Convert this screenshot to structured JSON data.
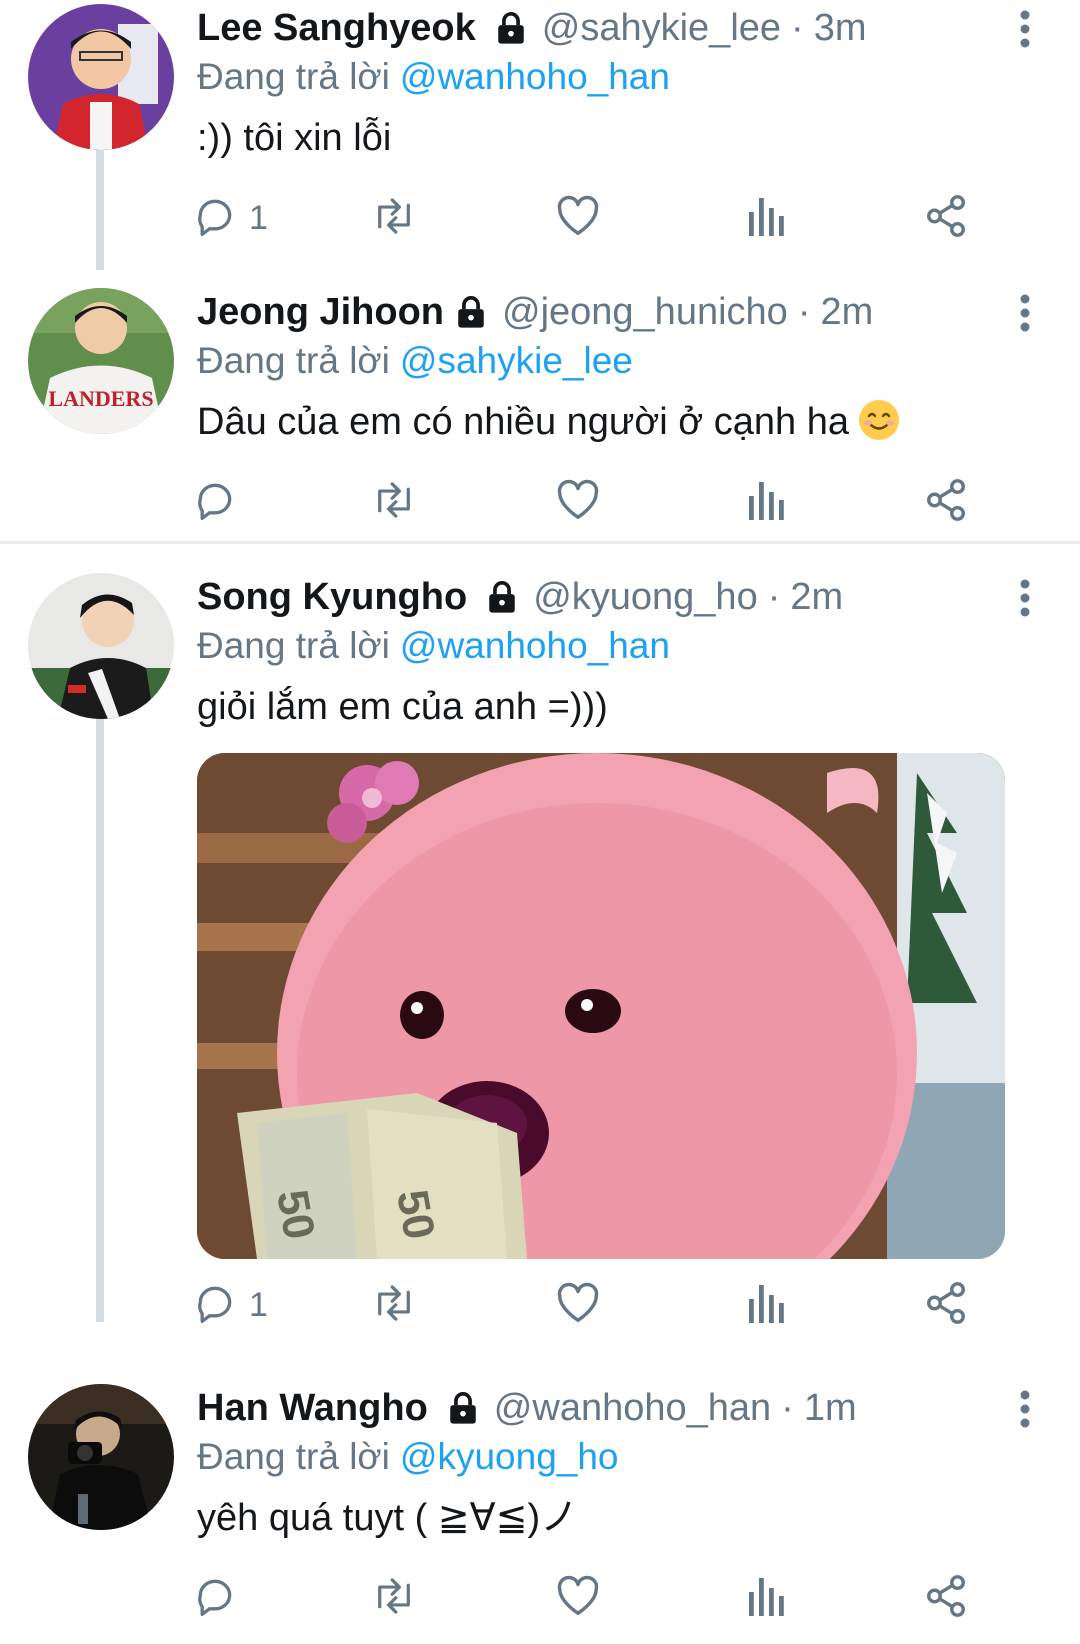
{
  "tweets": [
    {
      "name": "Lee Sanghyeok",
      "handle": "@sahykie_lee",
      "time": "3m",
      "replying_label": "Đang trả lời",
      "replying_to": "@wanhoho_han",
      "text": ":)) tôi xin lỗi",
      "reply_count": "1"
    },
    {
      "name": "Jeong Jihoon",
      "handle": "@jeong_hunicho",
      "time": "2m",
      "replying_label": "Đang trả lời",
      "replying_to": "@sahykie_lee",
      "text": "Dâu của em có nhiều người ở cạnh ha",
      "reply_count": ""
    },
    {
      "name": "Song Kyungho",
      "handle": "@kyuong_ho",
      "time": "2m",
      "replying_label": "Đang trả lời",
      "replying_to": "@wanhoho_han",
      "text": "giỏi lắm em của anh =)))",
      "reply_count": "1",
      "media_caption": "50"
    },
    {
      "name": "Han Wangho",
      "handle": "@wanhoho_han",
      "time": "1m",
      "replying_label": "Đang trả lời",
      "replying_to": "@kyuong_ho",
      "text": "yêh quá tuyt ( ≧∀≦)ノ",
      "reply_count": ""
    }
  ],
  "separator": "·",
  "icons": {
    "lock": "lock-icon",
    "more": "more-vertical-icon",
    "reply": "reply-icon",
    "retweet": "retweet-icon",
    "like": "heart-icon",
    "analytics": "analytics-icon",
    "share": "share-icon",
    "emoji": "smiling-face-emoji"
  },
  "colors": {
    "accent": "#1da1f2",
    "secondary_text": "#657786",
    "thread_line": "#d5dce2"
  }
}
